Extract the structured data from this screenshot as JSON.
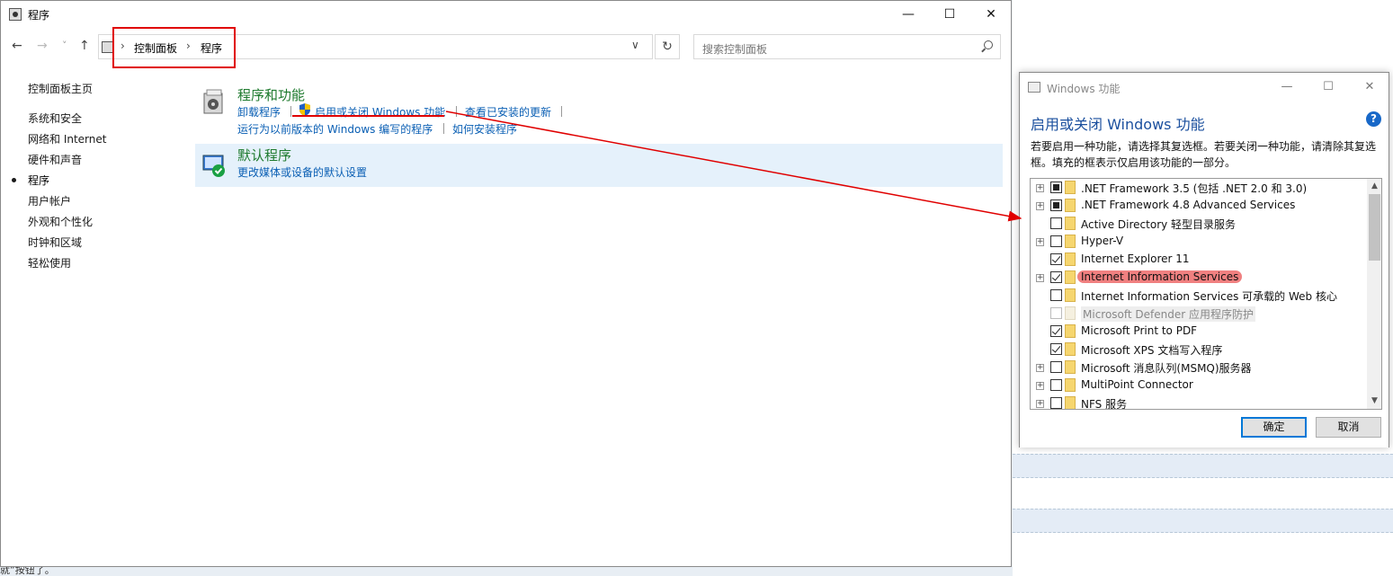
{
  "window": {
    "title": "程序"
  },
  "nav": {
    "back": "←",
    "forward": "→",
    "recent": "˅",
    "up": "↑",
    "dropdown": "∨",
    "refresh": "↻"
  },
  "address": {
    "crumb_sep1": "›",
    "crumb1": "控制面板",
    "crumb_sep2": "›",
    "crumb2": "程序"
  },
  "search": {
    "placeholder": "搜索控制面板"
  },
  "sidebar": {
    "home": "控制面板主页",
    "items": [
      {
        "label": "系统和安全"
      },
      {
        "label": "网络和 Internet"
      },
      {
        "label": "硬件和声音"
      },
      {
        "label": "程序",
        "active": true
      },
      {
        "label": "用户帐户"
      },
      {
        "label": "外观和个性化"
      },
      {
        "label": "时钟和区域"
      },
      {
        "label": "轻松使用"
      }
    ]
  },
  "categories": [
    {
      "title": "程序和功能",
      "links_row1": [
        "卸载程序",
        "启用或关闭 Windows 功能",
        "查看已安装的更新"
      ],
      "links_row2": [
        "运行为以前版本的 Windows 编写的程序",
        "如何安装程序"
      ]
    },
    {
      "title": "默认程序",
      "links_row1": [
        "更改媒体或设备的默认设置"
      ]
    }
  ],
  "dialog": {
    "title": "Windows 功能",
    "heading": "启用或关闭 Windows 功能",
    "help": "?",
    "description": "若要启用一种功能，请选择其复选框。若要关闭一种功能，请清除其复选框。填充的框表示仅启用该功能的一部分。",
    "features": [
      {
        "label": ".NET Framework 3.5 (包括 .NET 2.0 和 3.0)",
        "state": "partial",
        "expandable": true
      },
      {
        "label": ".NET Framework 4.8 Advanced Services",
        "state": "partial",
        "expandable": true
      },
      {
        "label": "Active Directory 轻型目录服务",
        "state": "unchecked",
        "expandable": false
      },
      {
        "label": "Hyper-V",
        "state": "unchecked",
        "expandable": true
      },
      {
        "label": "Internet Explorer 11",
        "state": "checked",
        "expandable": false
      },
      {
        "label": "Internet Information Services",
        "state": "checked",
        "expandable": true,
        "highlighted": true
      },
      {
        "label": "Internet Information Services 可承载的 Web 核心",
        "state": "unchecked",
        "expandable": false
      },
      {
        "label": "Microsoft Defender 应用程序防护",
        "state": "unchecked",
        "expandable": false,
        "disabled": true
      },
      {
        "label": "Microsoft Print to PDF",
        "state": "checked",
        "expandable": false
      },
      {
        "label": "Microsoft XPS 文档写入程序",
        "state": "checked",
        "expandable": false
      },
      {
        "label": "Microsoft 消息队列(MSMQ)服务器",
        "state": "unchecked",
        "expandable": true
      },
      {
        "label": "MultiPoint Connector",
        "state": "unchecked",
        "expandable": true
      },
      {
        "label": "NFS 服务",
        "state": "unchecked",
        "expandable": true
      }
    ],
    "ok": "确定",
    "cancel": "取消"
  },
  "background_text": "就”按钮了。",
  "colors": {
    "annotation": "#e00000",
    "link": "#0a5fb4",
    "category_title": "#1e7a2e",
    "highlight": "#f08080"
  }
}
